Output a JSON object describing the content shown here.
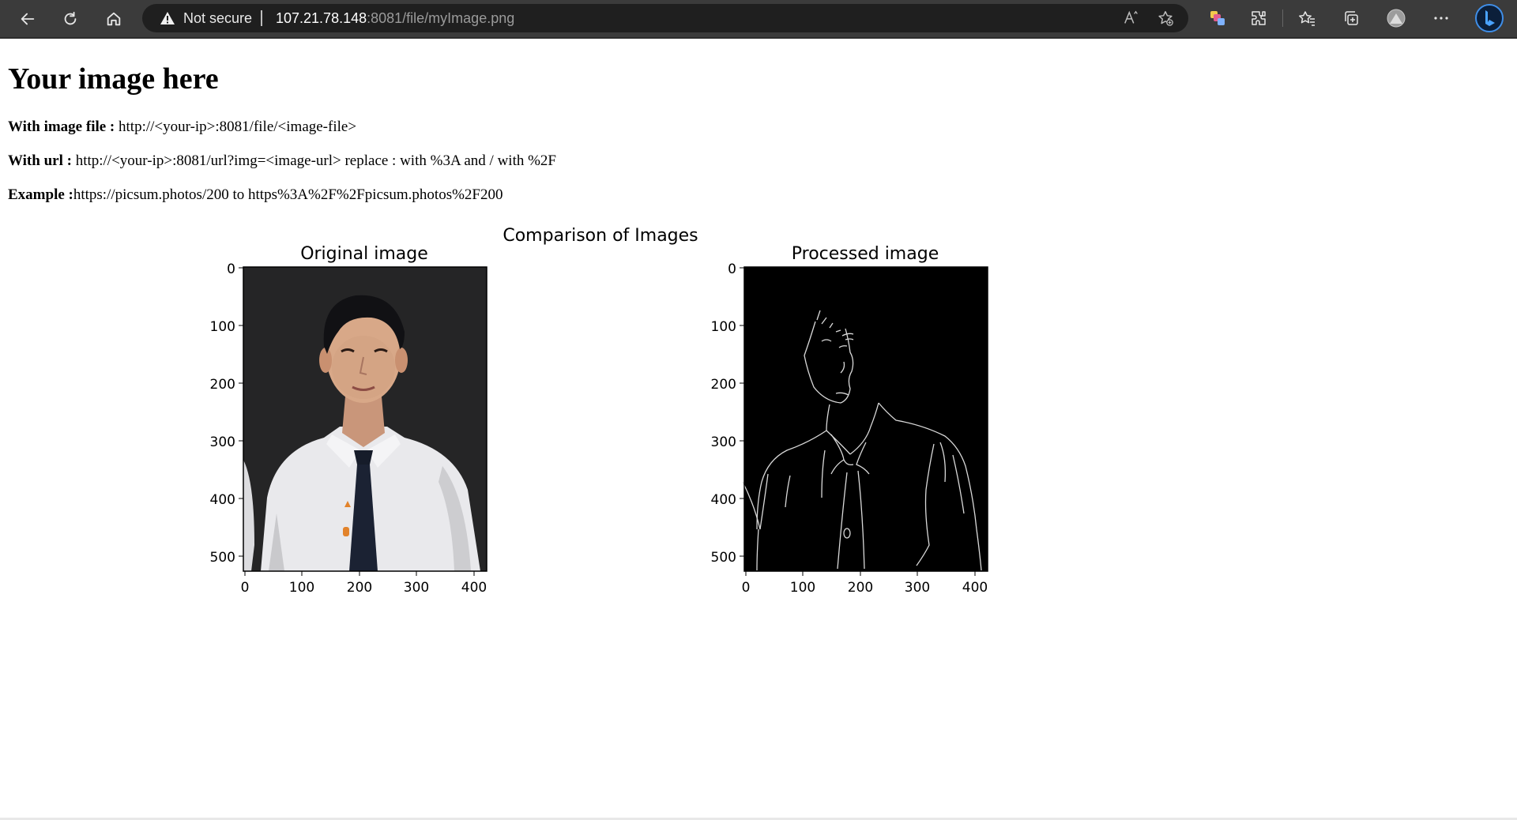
{
  "browser": {
    "security_label": "Not secure",
    "url_host": "107.21.78.148",
    "url_path": ":8081/file/myImage.png",
    "icons": [
      "back-icon",
      "refresh-icon",
      "home-icon",
      "warning-icon",
      "read-aloud-icon",
      "add-favorite-icon",
      "copilot-icon",
      "extensions-icon",
      "favorites-icon",
      "collections-icon",
      "profile-avatar",
      "more-icon",
      "bing-icon"
    ]
  },
  "page": {
    "title": "Your image here",
    "line1_label": "With image file :",
    "line1_value": " http://<your-ip>:8081/file/<image-file>",
    "line2_label": "With url :",
    "line2_value": " http://<your-ip>:8081/url?img=<image-url> replace : with %3A and / with %2F",
    "line3_label": "Example :",
    "line3_value": "https://picsum.photos/200 to https%3A%2F%2Fpicsum.photos%2F200"
  },
  "figure": {
    "suptitle": "Comparison of Images",
    "panels": [
      {
        "title": "Original image",
        "xticks": [
          "0",
          "100",
          "200",
          "300",
          "400"
        ],
        "yticks": [
          "0",
          "100",
          "200",
          "300",
          "400",
          "500"
        ],
        "x_range": [
          0,
          425
        ],
        "y_range": [
          0,
          530
        ]
      },
      {
        "title": "Processed image",
        "xticks": [
          "0",
          "100",
          "200",
          "300",
          "400"
        ],
        "yticks": [
          "0",
          "100",
          "200",
          "300",
          "400",
          "500"
        ],
        "x_range": [
          0,
          425
        ],
        "y_range": [
          0,
          530
        ]
      }
    ]
  }
}
